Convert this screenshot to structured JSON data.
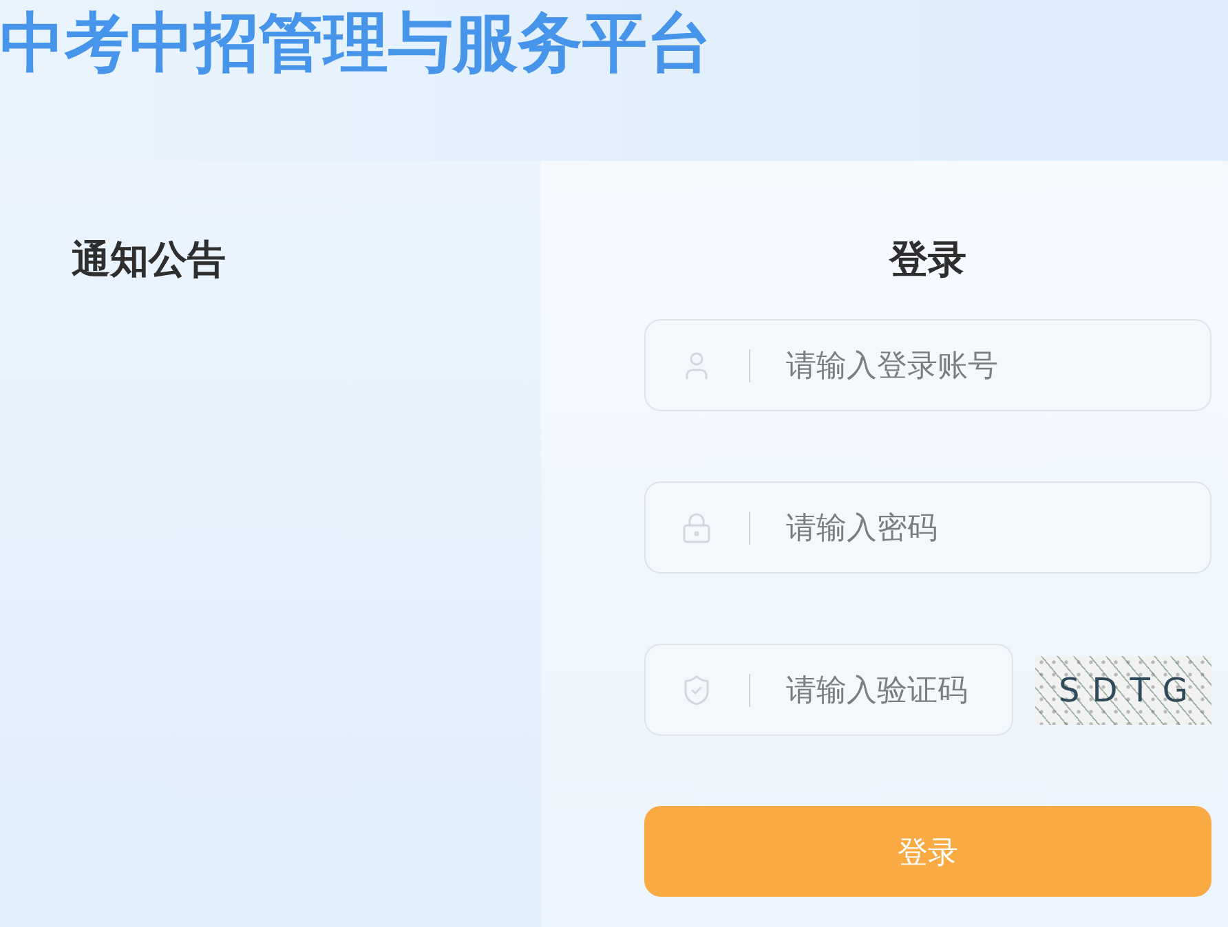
{
  "header": {
    "title": "中考中招管理与服务平台"
  },
  "notice_panel": {
    "title": "通知公告"
  },
  "login_panel": {
    "title": "登录",
    "fields": [
      {
        "kind": "account",
        "placeholder": "请输入登录账号"
      },
      {
        "kind": "password",
        "placeholder": "请输入密码"
      },
      {
        "kind": "captcha",
        "placeholder": "请输入验证码",
        "captcha_code": "SDTG"
      }
    ],
    "button": "登录"
  }
}
